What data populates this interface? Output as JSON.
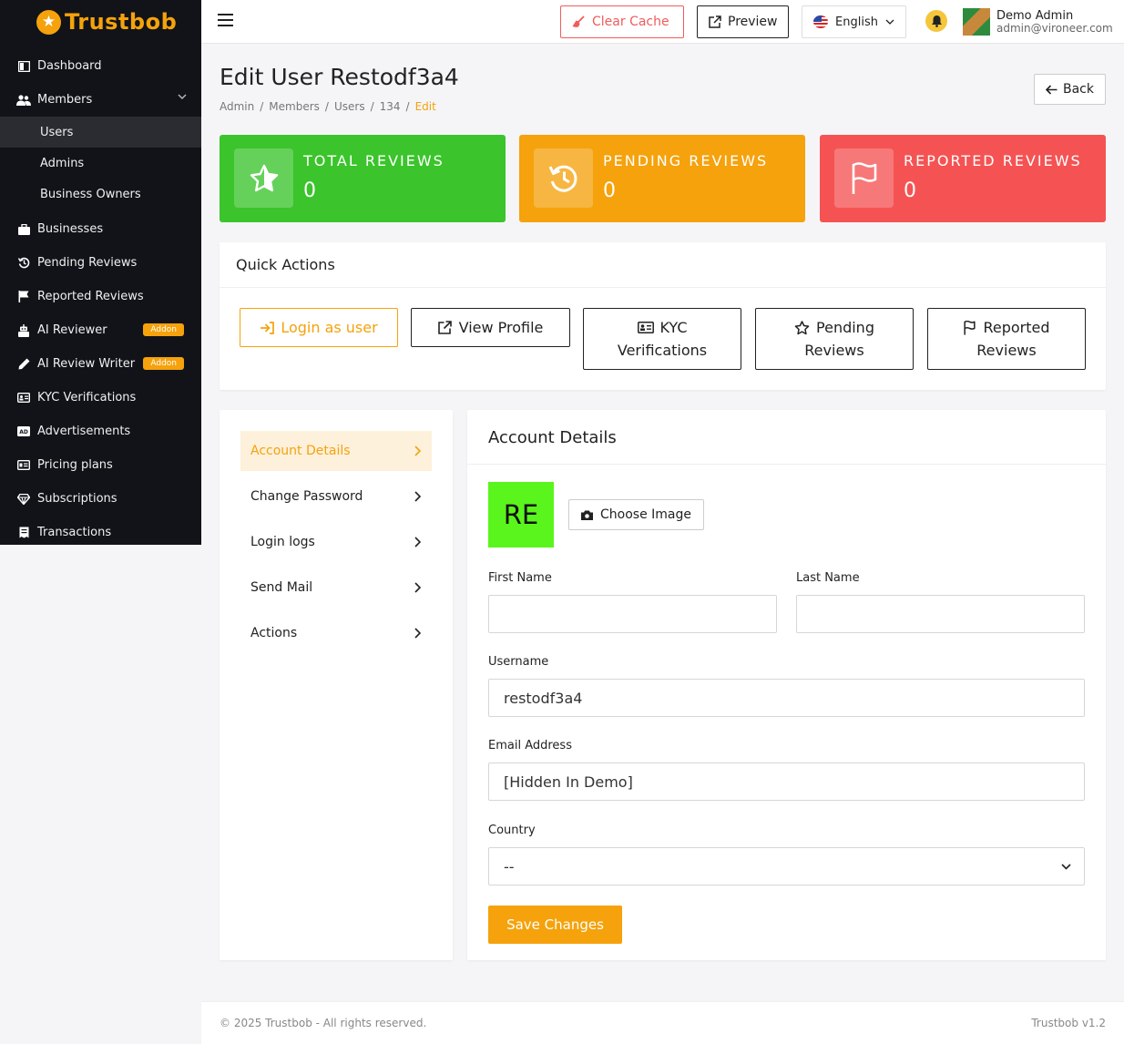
{
  "brand": {
    "name": "Trustbob"
  },
  "sidebar": {
    "items": [
      {
        "label": "Dashboard",
        "icon": "dashboard-icon"
      },
      {
        "label": "Members",
        "icon": "users-icon"
      },
      {
        "label": "Businesses",
        "icon": "briefcase-icon"
      },
      {
        "label": "Pending Reviews",
        "icon": "history-icon"
      },
      {
        "label": "Reported Reviews",
        "icon": "flag-icon"
      },
      {
        "label": "AI Reviewer",
        "icon": "robot-icon",
        "badge": "Addon"
      },
      {
        "label": "AI Review Writer",
        "icon": "pen-icon",
        "badge": "Addon"
      },
      {
        "label": "KYC Verifications",
        "icon": "id-card-icon"
      },
      {
        "label": "Advertisements",
        "icon": "ad-icon"
      },
      {
        "label": "Pricing plans",
        "icon": "pricing-icon"
      },
      {
        "label": "Subscriptions",
        "icon": "gem-icon"
      },
      {
        "label": "Transactions",
        "icon": "receipt-icon"
      }
    ],
    "members_sub": [
      "Users",
      "Admins",
      "Business Owners"
    ]
  },
  "topbar": {
    "clear_cache": "Clear Cache",
    "preview": "Preview",
    "language": "English",
    "user_name": "Demo Admin",
    "user_email": "admin@vironeer.com"
  },
  "page": {
    "title": "Edit User Restodf3a4",
    "back": "Back",
    "breadcrumb": [
      "Admin",
      "Members",
      "Users",
      "134",
      "Edit"
    ]
  },
  "stats": [
    {
      "label": "TOTAL REVIEWS",
      "value": "0",
      "color": "#3bc42c"
    },
    {
      "label": "PENDING REVIEWS",
      "value": "0",
      "color": "#f5a20c"
    },
    {
      "label": "REPORTED REVIEWS",
      "value": "0",
      "color": "#f55353"
    }
  ],
  "quick_actions": {
    "title": "Quick Actions",
    "login": "Login as user",
    "view_profile": "View Profile",
    "kyc_1": "KYC",
    "kyc_2": "Verifications",
    "pending_1": "Pending",
    "pending_2": "Reviews",
    "reported_1": "Reported",
    "reported_2": "Reviews"
  },
  "side_menu": [
    "Account Details",
    "Change Password",
    "Login logs",
    "Send Mail",
    "Actions"
  ],
  "form": {
    "title": "Account Details",
    "initials": "RE",
    "choose_image": "Choose Image",
    "first_name_label": "First Name",
    "first_name_value": "",
    "last_name_label": "Last Name",
    "last_name_value": "",
    "username_label": "Username",
    "username_value": "restodf3a4",
    "email_label": "Email Address",
    "email_value": "[Hidden In Demo]",
    "country_label": "Country",
    "country_value": "--",
    "save": "Save Changes"
  },
  "footer": {
    "copyright": "© 2025 Trustbob - All rights reserved.",
    "version": "Trustbob v1.2"
  }
}
